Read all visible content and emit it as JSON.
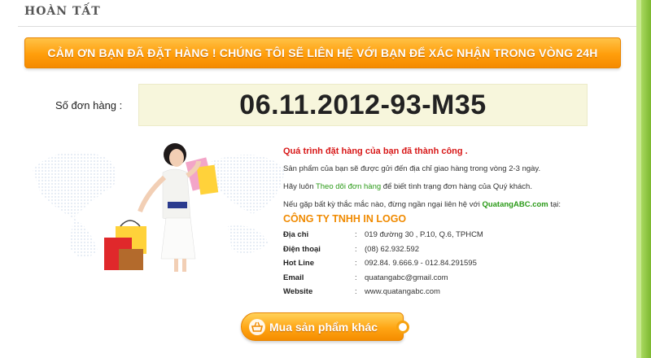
{
  "section": {
    "title": "HOÀN TẤT"
  },
  "banner": {
    "text": "CẢM ƠN BẠN ĐÃ ĐẶT HÀNG ! CHÚNG TÔI SẼ LIÊN HỆ VỚI BẠN ĐỂ XÁC NHẬN TRONG VÒNG 24H"
  },
  "order": {
    "label": "Số đơn hàng :",
    "number": "06.11.2012-93-M35"
  },
  "info": {
    "success": "Quá trình đặt hàng của bạn đã thành công .",
    "line1": "Sản phẩm của bạn sẽ được gửi đến địa chỉ giao hàng trong vòng 2-3 ngày.",
    "line2_pre": "Hãy luôn ",
    "line2_link": "Theo dõi đơn hàng",
    "line2_post": " để biết tình trạng đơn hàng của Quý khách.",
    "line3_pre": "Nếu gặp bất kỳ thắc mắc nào, đừng ngần ngại liên hệ với ",
    "line3_link": "QuatangABC.com",
    "line3_post": " tại:"
  },
  "company": {
    "name": "CÔNG TY TNHH IN LOGO",
    "rows": [
      {
        "key": "Địa chỉ",
        "value": "019 đường 30 , P.10, Q.6, TPHCM"
      },
      {
        "key": "Điện thoại",
        "value": "(08) 62.932.592"
      },
      {
        "key": "Hot Line",
        "value": "092.84. 9.666.9 - 012.84.291595"
      },
      {
        "key": "Email",
        "value": "quatangabc@gmail.com"
      },
      {
        "key": "Website",
        "value": "www.quatangabc.com"
      }
    ]
  },
  "button": {
    "label": "Mua sản phẩm khác"
  },
  "colors": {
    "accent": "#ff9e0b",
    "success_red": "#d81818",
    "link_green": "#2a9a17",
    "frame_green": "#8cc63f"
  }
}
